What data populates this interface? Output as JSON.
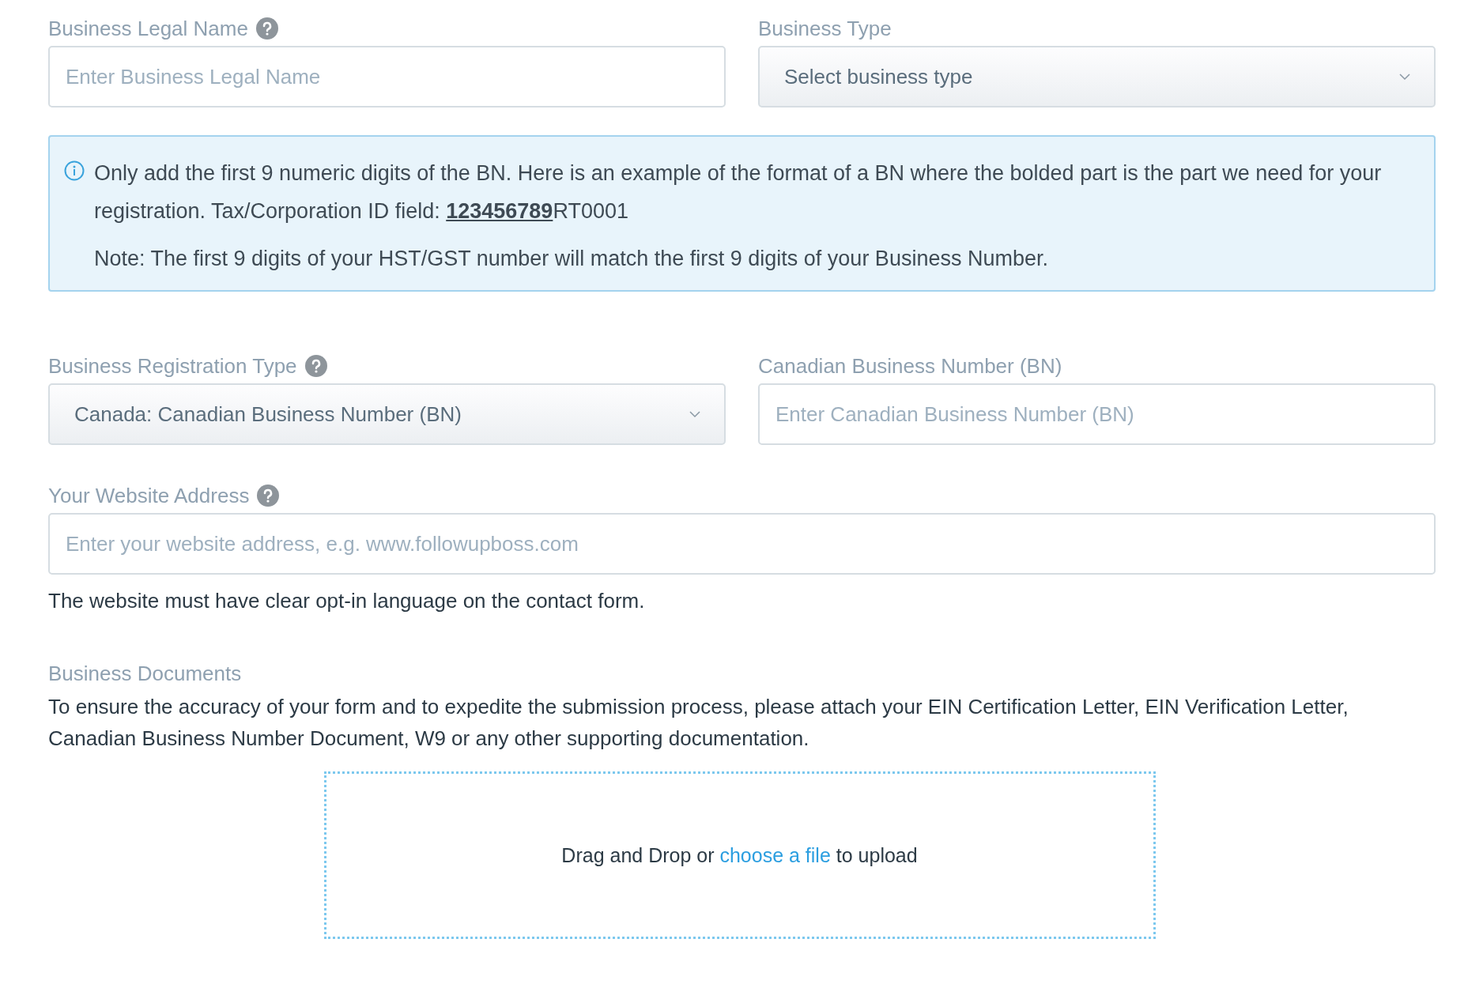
{
  "top_fields": [
    {
      "label": "Business Legal Name",
      "help": true,
      "kind": "text",
      "placeholder": "Enter Business Legal Name"
    },
    {
      "label": "Business Type",
      "help": false,
      "kind": "select",
      "value": "Select business type"
    }
  ],
  "info_box": {
    "paragraphs": [
      "Only add the first 9 numeric digits of the BN. Here is an example of the format of a BN where the bolded part is the part we need for your registration. Tax/Corporation ID field: **123456789**RT0001",
      "Note: The first 9 digits of your HST/GST number will match the first 9 digits of your Business Number."
    ]
  },
  "middle_fields": [
    {
      "label": "Business Registration Type",
      "help": true,
      "kind": "select",
      "value": "Canada: Canadian Business Number (BN)"
    },
    {
      "label": "Canadian Business Number (BN)",
      "help": false,
      "kind": "text",
      "placeholder": "Enter Canadian Business Number (BN)"
    }
  ],
  "website": {
    "label": "Your Website Address",
    "help": true,
    "kind": "text",
    "placeholder": "Enter your website address, e.g. www.followupboss.com",
    "note": "The website must have clear opt-in language on the contact form."
  },
  "documents": {
    "title": "Business Documents",
    "description": "To ensure the accuracy of your form and to expedite the submission process, please attach your EIN Certification Letter, EIN Verification Letter, Canadian Business Number Document, W9 or any other supporting documentation.",
    "dropzone": {
      "text_before": "Drag and Drop or",
      "link": "choose a file",
      "text_after": "to upload"
    }
  }
}
